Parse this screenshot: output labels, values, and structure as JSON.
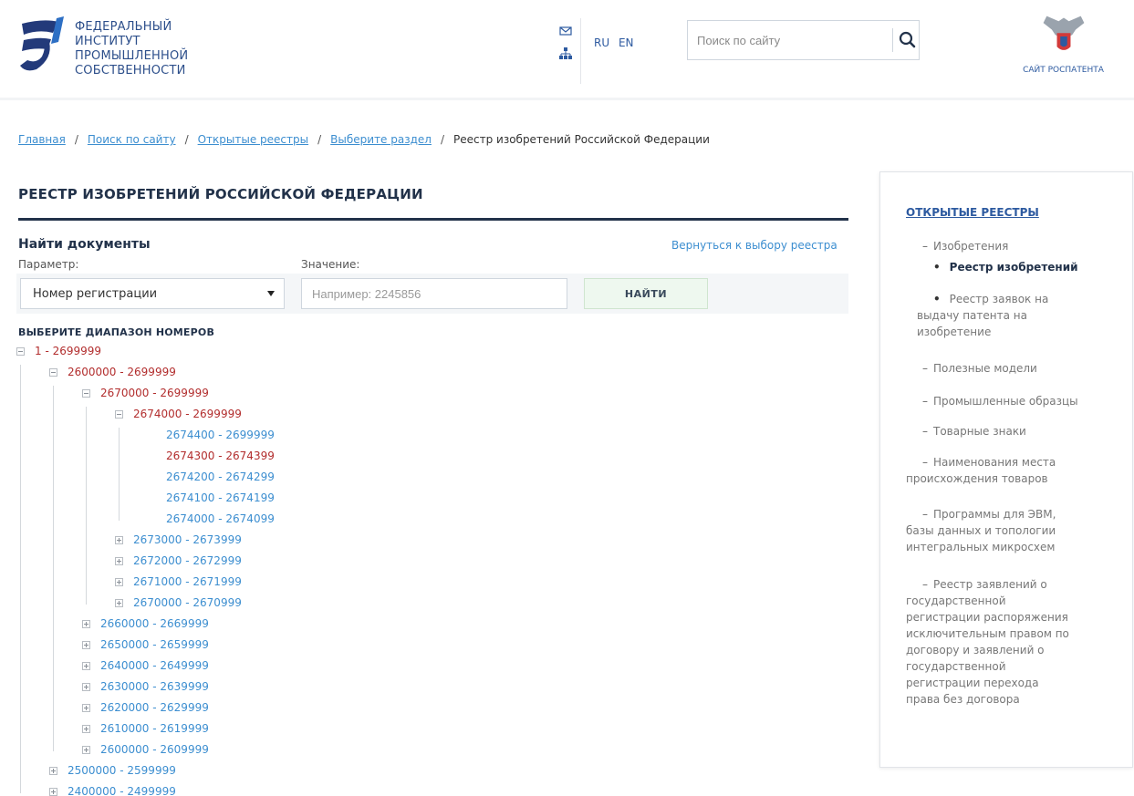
{
  "header": {
    "org_name_lines": [
      "Федеральный",
      "институт",
      "промышленной",
      "собственности"
    ],
    "icons": [
      "mail-icon",
      "sitemap-icon"
    ],
    "languages": [
      "RU",
      "EN"
    ],
    "search_placeholder": "Поиск по сайту",
    "rospatent_label": "Сайт Роспатента"
  },
  "breadcrumb": {
    "items": [
      "Главная",
      "Поиск по сайту",
      "Открытые реестры",
      "Выберите раздел"
    ],
    "current": "Реестр изобретений Российской Федерации",
    "separator": "/"
  },
  "main": {
    "title": "Реестр изобретений Российской Федерации",
    "find_heading": "Найти документы",
    "back_link": "Вернуться к выбору реестра",
    "param_label": "Параметр:",
    "value_label": "Значение:",
    "param_selected": "Номер регистрации",
    "value_placeholder": "Например: 2245856",
    "find_button": "найти",
    "range_heading": "Выберите диапазон номеров"
  },
  "tree": [
    {
      "label": "1 - 2699999",
      "level": 0,
      "color": "red",
      "toggle": "minus"
    },
    {
      "label": "2600000 - 2699999",
      "level": 1,
      "color": "red",
      "toggle": "minus"
    },
    {
      "label": "2670000 - 2699999",
      "level": 2,
      "color": "red",
      "toggle": "minus"
    },
    {
      "label": "2674000 - 2699999",
      "level": 3,
      "color": "red",
      "toggle": "minus"
    },
    {
      "label": "2674400 - 2699999",
      "level": 4,
      "color": "blue",
      "toggle": "none"
    },
    {
      "label": "2674300 - 2674399",
      "level": 4,
      "color": "red",
      "toggle": "none"
    },
    {
      "label": "2674200 - 2674299",
      "level": 4,
      "color": "blue",
      "toggle": "none"
    },
    {
      "label": "2674100 - 2674199",
      "level": 4,
      "color": "blue",
      "toggle": "none"
    },
    {
      "label": "2674000 - 2674099",
      "level": 4,
      "color": "blue",
      "toggle": "none"
    },
    {
      "label": "2673000 - 2673999",
      "level": 3,
      "color": "blue",
      "toggle": "plus"
    },
    {
      "label": "2672000 - 2672999",
      "level": 3,
      "color": "blue",
      "toggle": "plus"
    },
    {
      "label": "2671000 - 2671999",
      "level": 3,
      "color": "blue",
      "toggle": "plus"
    },
    {
      "label": "2670000 - 2670999",
      "level": 3,
      "color": "blue",
      "toggle": "plus"
    },
    {
      "label": "2660000 - 2669999",
      "level": 2,
      "color": "blue",
      "toggle": "plus"
    },
    {
      "label": "2650000 - 2659999",
      "level": 2,
      "color": "blue",
      "toggle": "plus"
    },
    {
      "label": "2640000 - 2649999",
      "level": 2,
      "color": "blue",
      "toggle": "plus"
    },
    {
      "label": "2630000 - 2639999",
      "level": 2,
      "color": "blue",
      "toggle": "plus"
    },
    {
      "label": "2620000 - 2629999",
      "level": 2,
      "color": "blue",
      "toggle": "plus"
    },
    {
      "label": "2610000 - 2619999",
      "level": 2,
      "color": "blue",
      "toggle": "plus"
    },
    {
      "label": "2600000 - 2609999",
      "level": 2,
      "color": "blue",
      "toggle": "plus"
    },
    {
      "label": "2500000 - 2599999",
      "level": 1,
      "color": "blue",
      "toggle": "plus"
    },
    {
      "label": "2400000 - 2499999",
      "level": 1,
      "color": "blue",
      "toggle": "plus"
    }
  ],
  "sidebar": {
    "title": "Открытые реестры",
    "items": [
      {
        "lines": [
          "Изобретения"
        ],
        "type": "section",
        "active": false
      },
      {
        "lines": [
          "Реестр изобретений"
        ],
        "type": "sub",
        "active": true
      },
      {
        "lines": [
          "Реестр заявок на",
          "выдачу патента на",
          "изобретение"
        ],
        "type": "sub",
        "active": false
      },
      {
        "lines": [
          "Полезные модели"
        ],
        "type": "section",
        "active": false
      },
      {
        "lines": [
          "Промышленные образцы"
        ],
        "type": "section",
        "active": false
      },
      {
        "lines": [
          "Товарные знаки"
        ],
        "type": "section",
        "active": false
      },
      {
        "lines": [
          "Наименования места",
          "происхождения товаров"
        ],
        "type": "section",
        "active": false
      },
      {
        "lines": [
          "Программы для ЭВМ,",
          "базы данных и топологии",
          "интегральных микросхем"
        ],
        "type": "section",
        "active": false
      },
      {
        "lines": [
          "Реестр заявлений о",
          "государственной",
          "регистрации распоряжения",
          "исключительным правом по",
          "договору и заявлений о",
          "государственной",
          "регистрации перехода",
          "права без договора"
        ],
        "type": "section",
        "active": false
      }
    ]
  },
  "colors": {
    "navy": "#22324a",
    "link_blue": "#3c8ed0",
    "tree_red": "#b22d2d",
    "button_green_bg": "#eef8ef"
  }
}
